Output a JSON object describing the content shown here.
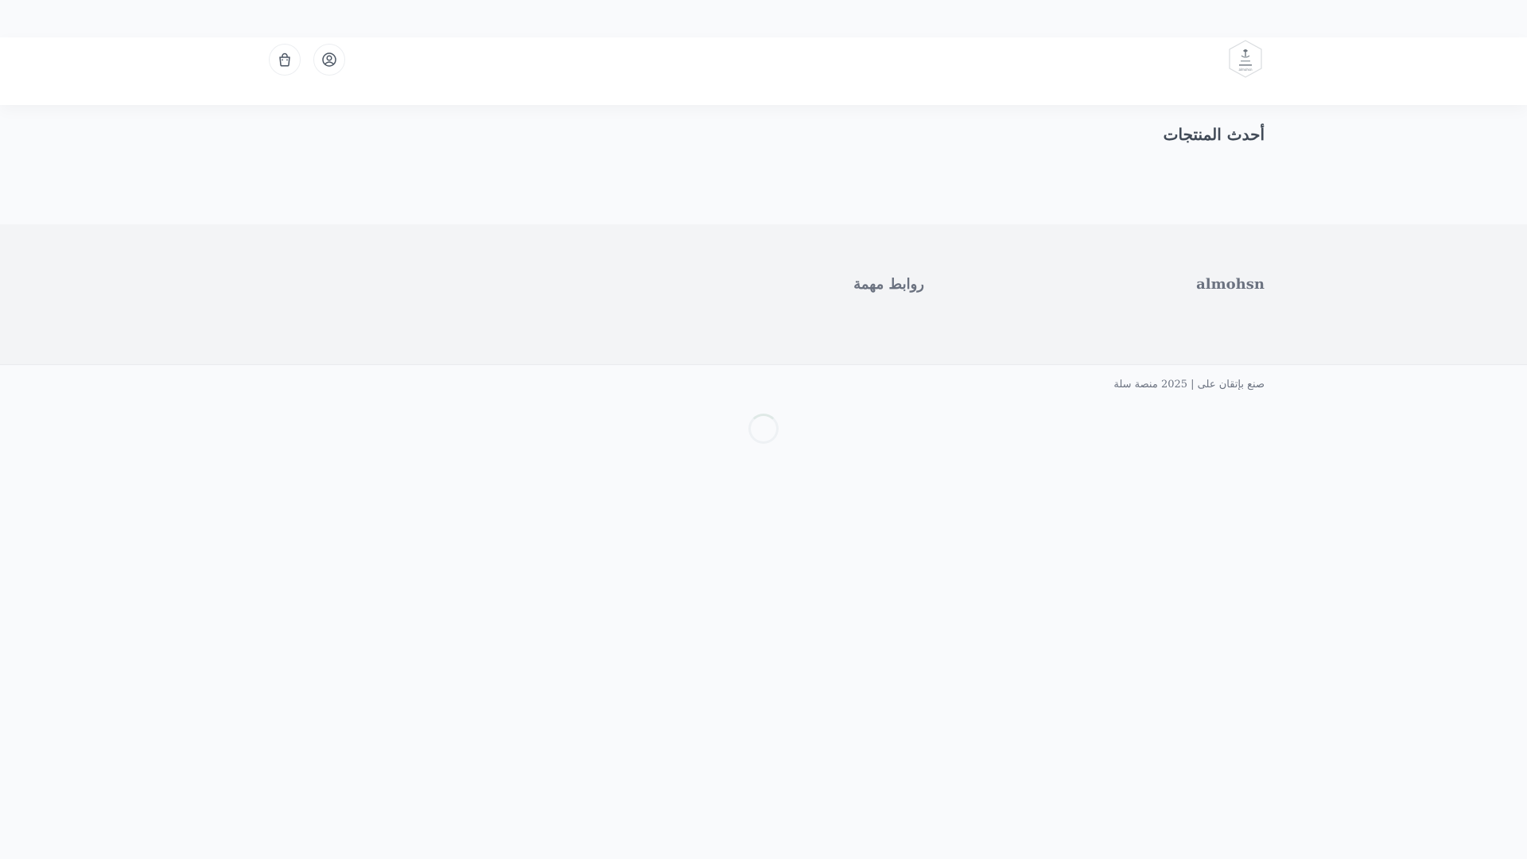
{
  "header": {
    "logo_icon": "store-logo-icon",
    "logo_caption": "almohsn",
    "account_icon": "user-icon",
    "cart_icon": "shopping-bag-icon"
  },
  "main": {
    "section_title": "أحدث المنتجات"
  },
  "footer": {
    "brand": "almohsn",
    "links_title": "روابط مهمة",
    "copyright": "صنع بإتقان على | 2025 منصة سلة"
  },
  "loading_indicator": "loading-spinner-icon",
  "colors": {
    "background": "#f9fafc",
    "header": "#ffffff",
    "footer": "#f3f4f6",
    "title_text": "#414a57",
    "muted_text": "#6b7280"
  }
}
